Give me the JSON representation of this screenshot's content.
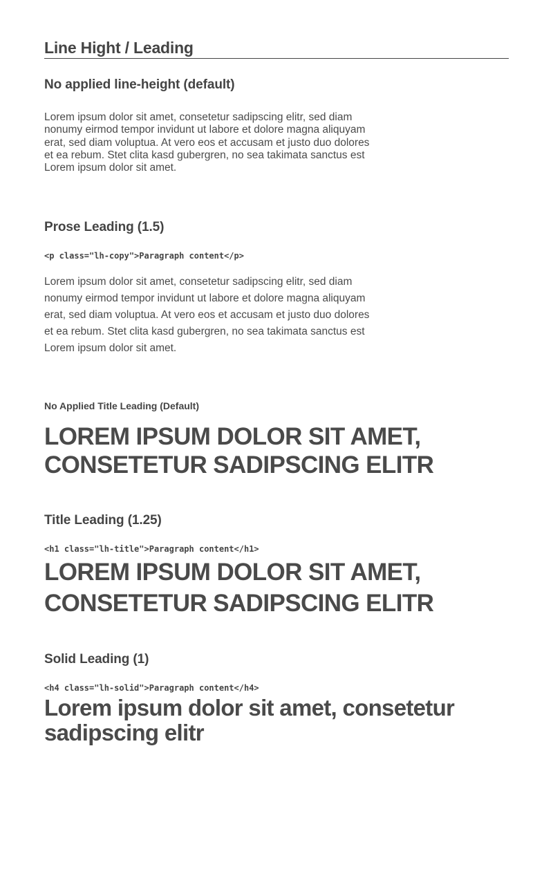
{
  "page": {
    "title": "Line Hight / Leading"
  },
  "sections": {
    "default_copy": {
      "heading": "No applied line-height (default)",
      "body": "Lorem ipsum dolor sit amet, consetetur sadipscing elitr, sed diam nonumy eirmod tempor invidunt ut labore et dolore magna aliquyam erat, sed diam voluptua. At vero eos et accusam et justo duo dolores et ea rebum. Stet clita kasd gubergren, no sea takimata sanctus est Lorem ipsum dolor sit amet."
    },
    "prose": {
      "heading": "Prose Leading (1.5)",
      "code": "<p class=\"lh-copy\">Paragraph content</p>",
      "body": "Lorem ipsum dolor sit amet, consetetur sadipscing elitr, sed diam nonumy eirmod tempor invidunt ut labore et dolore magna aliquyam erat, sed diam voluptua. At vero eos et accusam et justo duo dolores et ea rebum. Stet clita kasd gubergren, no sea takimata sanctus est Lorem ipsum dolor sit amet."
    },
    "default_title": {
      "heading": "No Applied Title Leading (Default)",
      "title": "LOREM IPSUM DOLOR SIT AMET, CONSETETUR SADIPSCING ELITR"
    },
    "title_leading": {
      "heading": "Title Leading (1.25)",
      "code": "<h1 class=\"lh-title\">Paragraph content</h1>",
      "title": "LOREM IPSUM DOLOR SIT AMET, CONSETETUR SADIPSCING ELITR"
    },
    "solid": {
      "heading": "Solid Leading (1)",
      "code": "<h4 class=\"lh-solid\">Paragraph content</h4>",
      "title": "Lorem ipsum dolor sit amet, consetetur sadipscing elitr"
    }
  }
}
